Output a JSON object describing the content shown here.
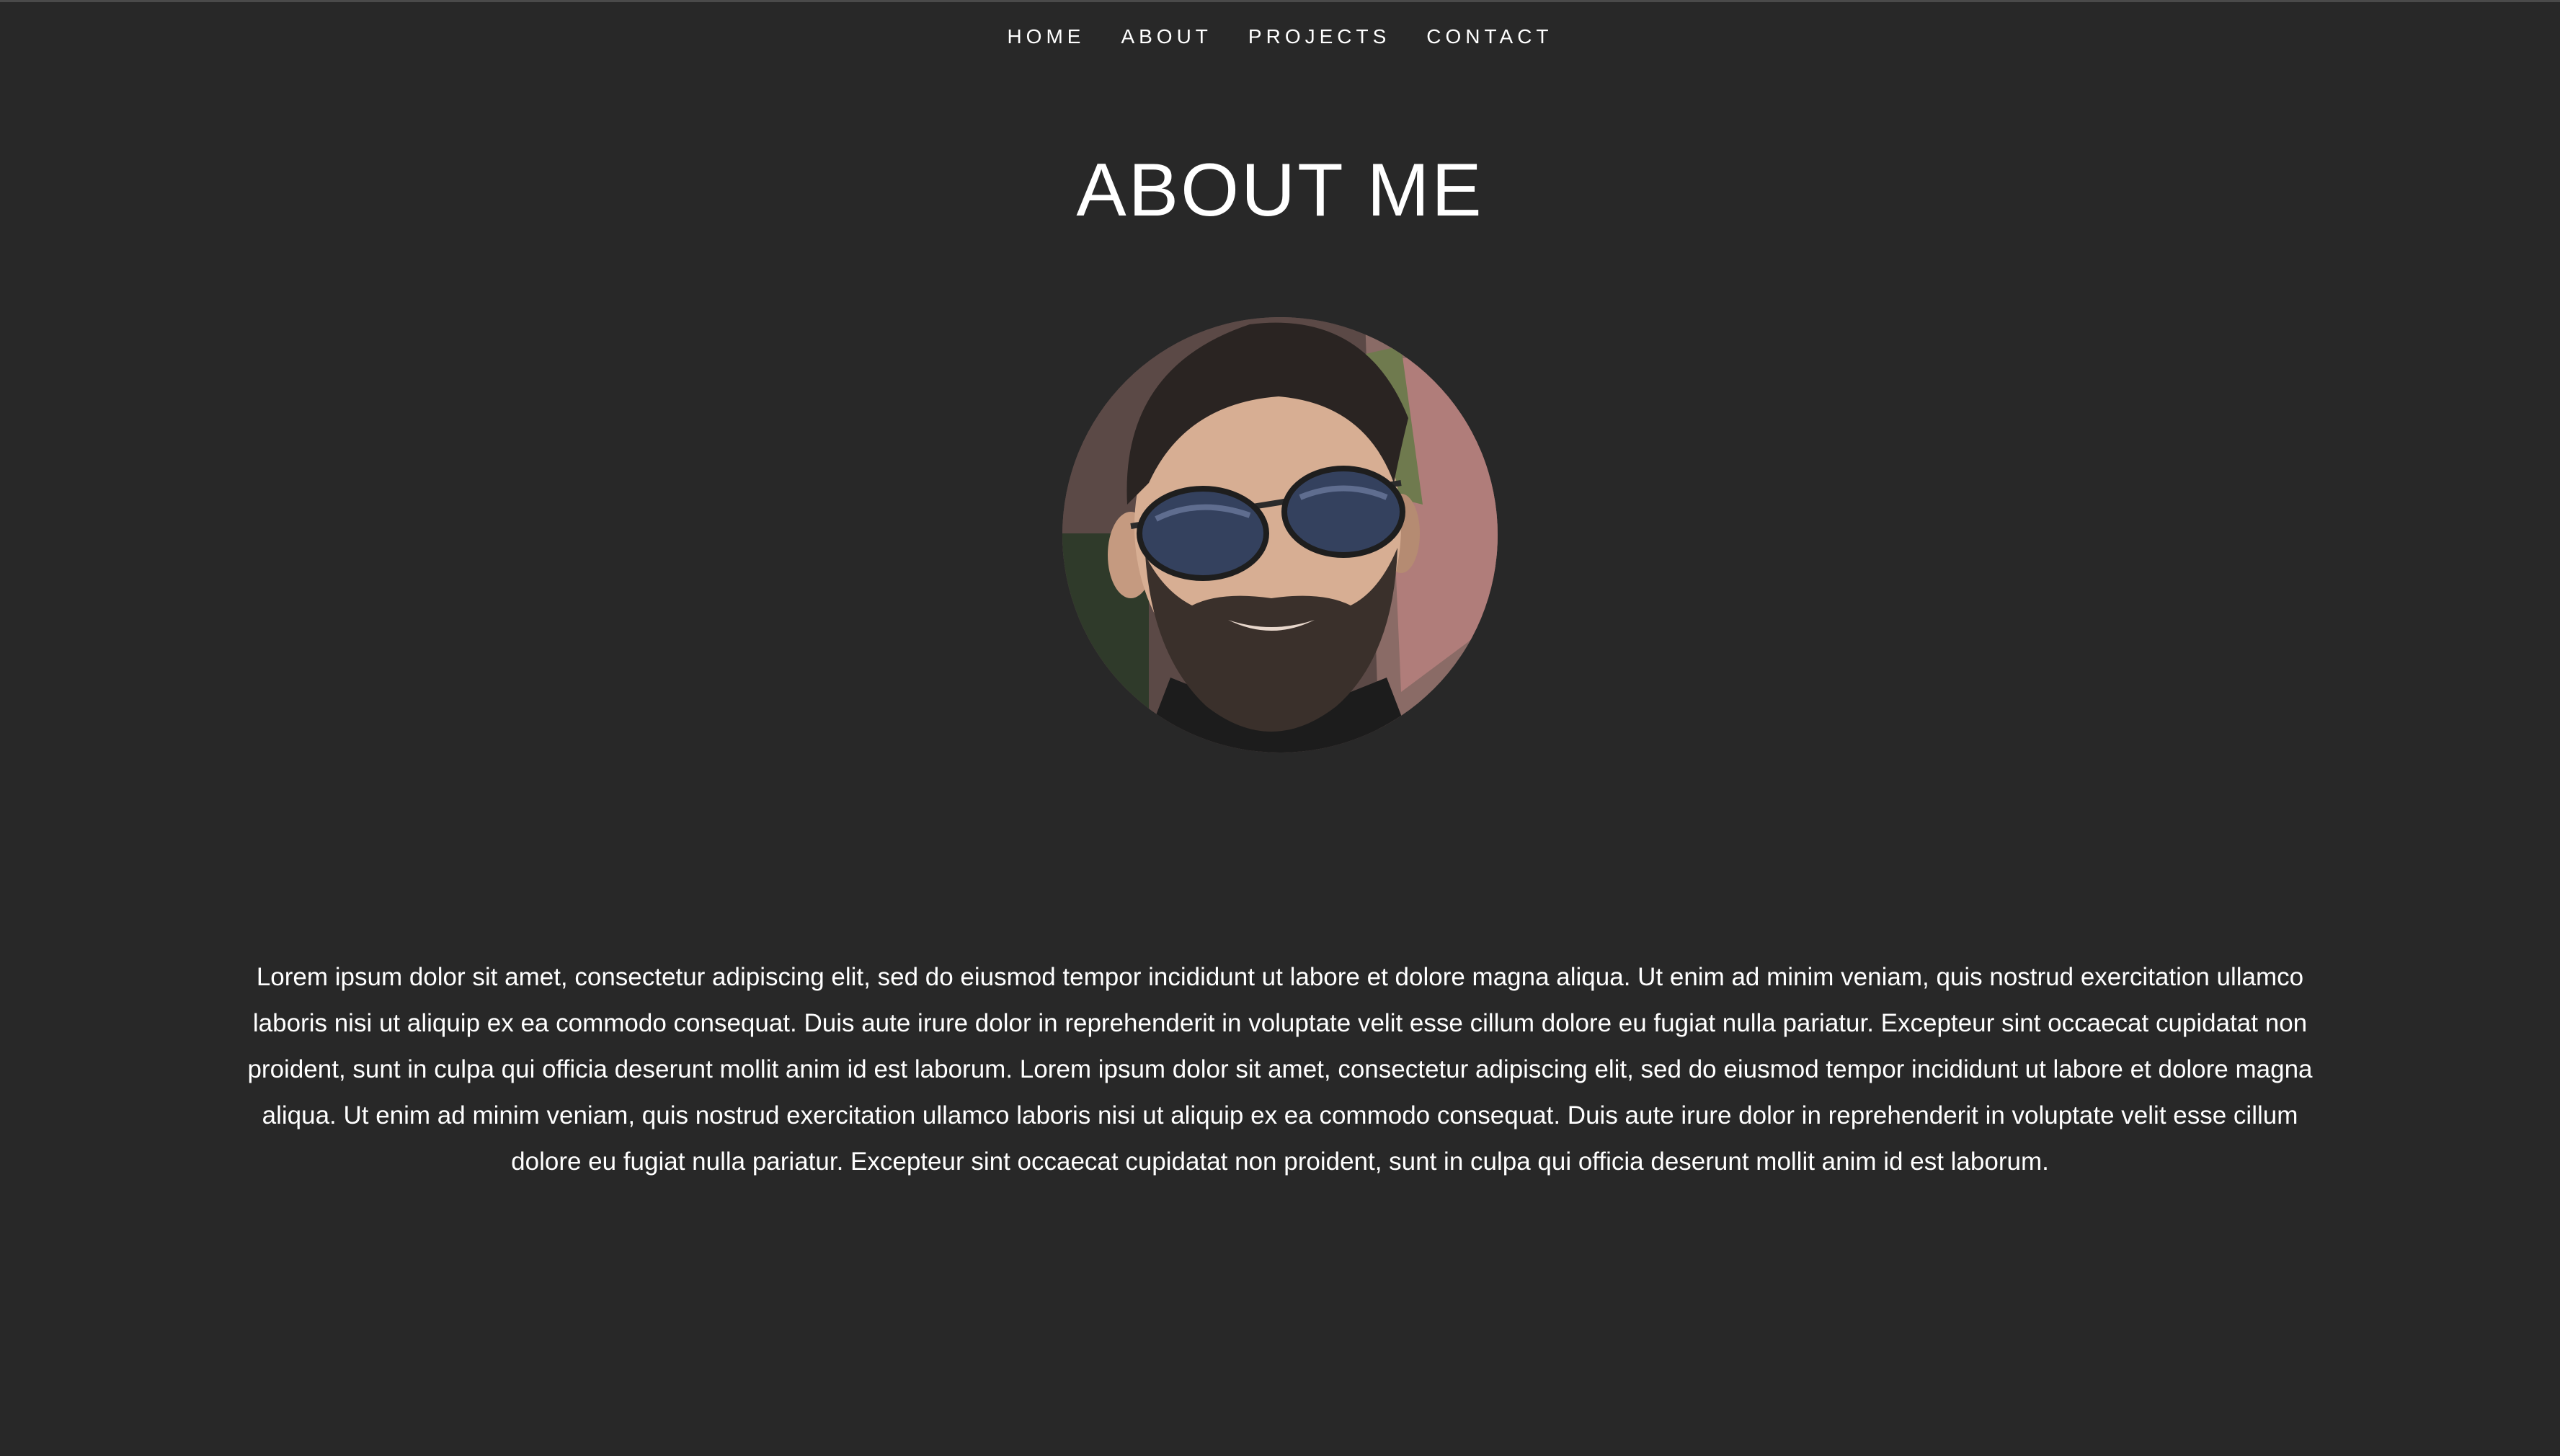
{
  "nav": {
    "items": [
      {
        "label": "HOME"
      },
      {
        "label": "ABOUT"
      },
      {
        "label": "PROJECTS"
      },
      {
        "label": "CONTACT"
      }
    ]
  },
  "page": {
    "title": "ABOUT ME"
  },
  "bio": {
    "text": "Lorem ipsum dolor sit amet, consectetur adipiscing elit, sed do eiusmod tempor incididunt ut labore et dolore magna aliqua. Ut enim ad minim veniam, quis nostrud exercitation ullamco laboris nisi ut aliquip ex ea commodo consequat. Duis aute irure dolor in reprehenderit in voluptate velit esse cillum dolore eu fugiat nulla pariatur. Excepteur sint occaecat cupidatat non proident, sunt in culpa qui officia deserunt mollit anim id est laborum. Lorem ipsum dolor sit amet, consectetur adipiscing elit, sed do eiusmod tempor incididunt ut labore et dolore magna aliqua. Ut enim ad minim veniam, quis nostrud exercitation ullamco laboris nisi ut aliquip ex ea commodo consequat. Duis aute irure dolor in reprehenderit in voluptate velit esse cillum dolore eu fugiat nulla pariatur. Excepteur sint occaecat cupidatat non proident, sunt in culpa qui officia deserunt mollit anim id est laborum."
  },
  "colors": {
    "background": "#282828",
    "text": "#ffffff"
  }
}
